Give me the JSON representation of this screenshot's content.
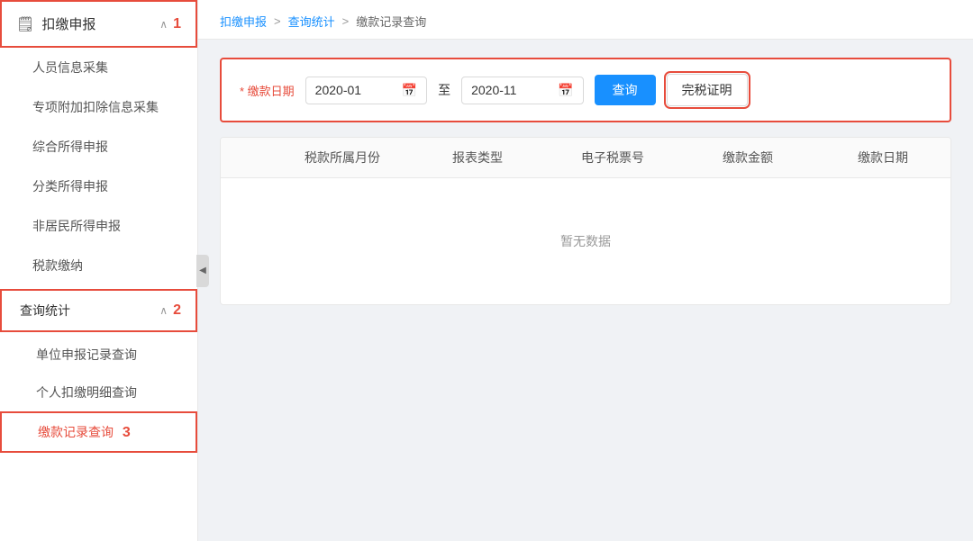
{
  "sidebar": {
    "main_title": "扣缴申报",
    "main_icon": "📋",
    "items": [
      {
        "id": "personnel",
        "label": "人员信息采集"
      },
      {
        "id": "special",
        "label": "专项附加扣除信息采集"
      },
      {
        "id": "comprehensive",
        "label": "综合所得申报"
      },
      {
        "id": "classified",
        "label": "分类所得申报"
      },
      {
        "id": "nonresident",
        "label": "非居民所得申报"
      },
      {
        "id": "tax-payment",
        "label": "税款缴纳"
      }
    ],
    "section2_label": "查询统计",
    "sub_items": [
      {
        "id": "unit-query",
        "label": "单位申报记录查询"
      },
      {
        "id": "personal-query",
        "label": "个人扣缴明细查询"
      },
      {
        "id": "payment-query",
        "label": "缴款记录查询",
        "active": true
      }
    ],
    "collapse_icon": "◀"
  },
  "breadcrumb": {
    "items": [
      {
        "id": "bc1",
        "label": "扣缴申报",
        "current": false
      },
      {
        "id": "bc2",
        "label": "查询统计",
        "current": false
      },
      {
        "id": "bc3",
        "label": "缴款记录查询",
        "current": true
      }
    ],
    "sep": ">"
  },
  "filter": {
    "label": "* 缴款日期",
    "date_from": "2020-01",
    "date_to": "2020-11",
    "date_icon": "📅",
    "to_label": "至",
    "query_btn": "查询",
    "cert_btn": "完税证明"
  },
  "table": {
    "columns": [
      "",
      "税款所属月份",
      "报表类型",
      "电子税票号",
      "缴款金额",
      "缴款日期"
    ],
    "empty_text": "暂无数据"
  }
}
